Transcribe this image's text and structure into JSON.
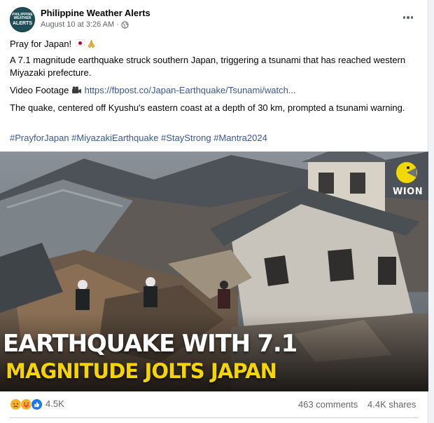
{
  "post": {
    "page_name": "Philippine Weather Alerts",
    "avatar_text": [
      "PHILIPPINE",
      "WEATHER",
      "ALERTS"
    ],
    "timestamp": "August 10 at 3:26 AM",
    "separator": "·",
    "privacy_icon": "globe-icon",
    "more_icon": "more-options-icon",
    "text": {
      "line1": "Pray for Japan!",
      "line2": "A 7.1 magnitude earthquake struck southern Japan, triggering a tsunami that has reached western Miyazaki prefecture.",
      "line3_prefix": "Video Footage",
      "line3_link": "https://fbpost.co/Japan-Earthquake/Tsunami/watch...",
      "line4": "The quake, centered off Kyushu's eastern coast at a depth of 30 km, prompted a tsunami warning.",
      "hashtags": "#PrayforJapan #MiyazakiEarthquake #StayStrong #Mantra2024"
    },
    "image": {
      "caption_line1": "EARTHQUAKE WITH 7.1",
      "caption_line2": "MAGNITUDE JOLTS JAPAN",
      "logo_text": "WION"
    },
    "stats": {
      "reactions": [
        "sad",
        "care",
        "like"
      ],
      "reaction_count": "4.5K",
      "comments": "463 comments",
      "shares": "4.4K shares"
    }
  },
  "colors": {
    "link": "#385898",
    "caption_yellow": "#f5d400",
    "like_blue": "#1877f2",
    "meta_gray": "#65676b"
  }
}
